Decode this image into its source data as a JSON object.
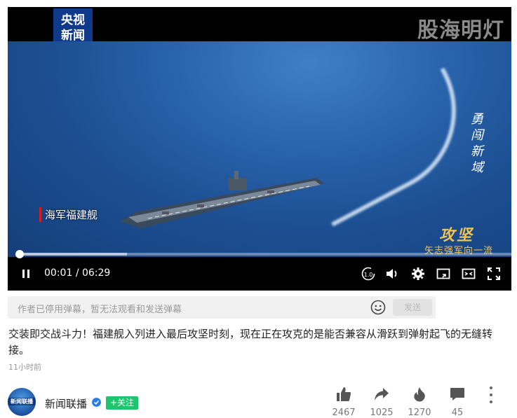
{
  "player": {
    "channel_logo": [
      "央视",
      "新闻"
    ],
    "watermark": "股海明灯",
    "caption": "海军福建舰",
    "vertical_text": "勇闯新域",
    "slogan_main": "攻坚",
    "slogan_sub": "矢志强军向一流",
    "current_time": "00:01",
    "separator": "/",
    "duration": "06:29",
    "progress": 0.002,
    "buffered": 0.22,
    "icons": [
      "pause-icon",
      "playback-speed-icon",
      "volume-icon",
      "settings-icon",
      "picture-in-picture-icon",
      "web-fullscreen-icon",
      "fullscreen-icon"
    ]
  },
  "danmaku": {
    "placeholder": "作者已停用弹幕，暂无法观看和发送弹幕",
    "send_label": "发送"
  },
  "post": {
    "description": "交装即交战斗力！福建舰入列进入最后攻坚时刻，现在正在攻克的是能否兼容从滑跃到弹射起飞的无缝转接。",
    "time_ago": "11小时前"
  },
  "author": {
    "avatar_text": "新闻联播",
    "name": "新闻联播",
    "follow_label": "+关注"
  },
  "actions": {
    "likes": "2467",
    "shares": "1025",
    "hot": "1270",
    "comments": "45"
  },
  "colors": {
    "accent_green": "#1fc46c",
    "verified_blue": "#2b7be8",
    "caption_red": "#d21f1f",
    "slogan_gold": "#f2c453"
  }
}
